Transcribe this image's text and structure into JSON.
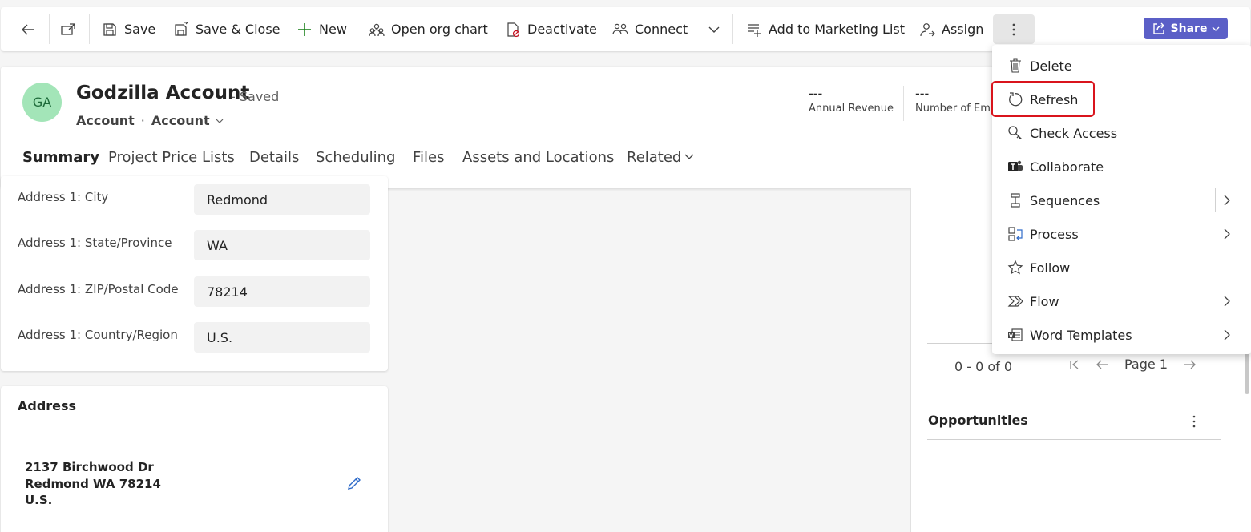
{
  "toolbar": {
    "save": "Save",
    "save_close": "Save & Close",
    "new": "New",
    "open_org_chart": "Open org chart",
    "deactivate": "Deactivate",
    "connect": "Connect",
    "add_marketing": "Add to Marketing List",
    "assign": "Assign",
    "share": "Share"
  },
  "record": {
    "initials": "GA",
    "title": "Godzilla Account",
    "saved_status": "- Saved",
    "entity": "Account",
    "form": "Account",
    "kpis": [
      {
        "value": "---",
        "label": "Annual Revenue"
      },
      {
        "value": "---",
        "label": "Number of Emp"
      }
    ]
  },
  "tabs": [
    "Summary",
    "Project Price Lists",
    "Details",
    "Scheduling",
    "Files",
    "Assets and Locations",
    "Related"
  ],
  "fields": [
    {
      "label": "Address 1: City",
      "value": "Redmond"
    },
    {
      "label": "Address 1: State/Province",
      "value": "WA"
    },
    {
      "label": "Address 1: ZIP/Postal Code",
      "value": "78214"
    },
    {
      "label": "Address 1: Country/Region",
      "value": "U.S."
    }
  ],
  "address_card": {
    "title": "Address",
    "lines": [
      "2137 Birchwood Dr",
      "Redmond WA 78214",
      "U.S."
    ]
  },
  "right_panel": {
    "record_count": "0 - 0 of 0",
    "page": "Page 1",
    "opportunities_title": "Opportunities"
  },
  "menu": {
    "items": [
      {
        "label": "Delete",
        "icon": "trash-icon",
        "submenu": false
      },
      {
        "label": "Refresh",
        "icon": "refresh-icon",
        "submenu": false
      },
      {
        "label": "Check Access",
        "icon": "key-search-icon",
        "submenu": false
      },
      {
        "label": "Collaborate",
        "icon": "teams-icon",
        "submenu": false
      },
      {
        "label": "Sequences",
        "icon": "sequence-icon",
        "submenu": true
      },
      {
        "label": "Process",
        "icon": "process-icon",
        "submenu": true
      },
      {
        "label": "Follow",
        "icon": "star-icon",
        "submenu": false
      },
      {
        "label": "Flow",
        "icon": "flow-icon",
        "submenu": true
      },
      {
        "label": "Word Templates",
        "icon": "word-template-icon",
        "submenu": true
      }
    ],
    "highlighted": "Refresh"
  },
  "colors": {
    "accent": "#5b5fc7",
    "highlight_border": "#d9141c",
    "avatar_bg": "#a3e5b8"
  }
}
